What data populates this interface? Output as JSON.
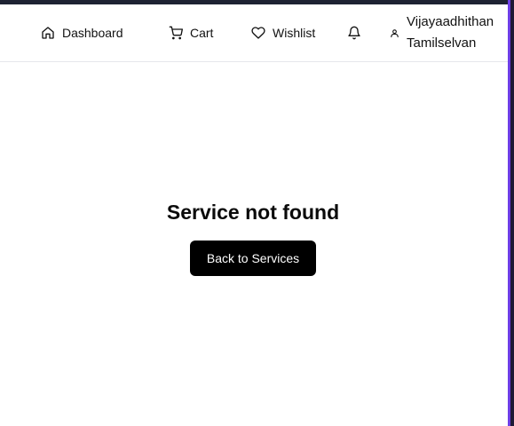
{
  "nav": {
    "dashboard": {
      "label": "Dashboard",
      "icon": "home-icon"
    },
    "cart": {
      "label": "Cart",
      "icon": "cart-icon"
    },
    "wishlist": {
      "label": "Wishlist",
      "icon": "heart-icon"
    },
    "notifications": {
      "icon": "bell-icon"
    },
    "user": {
      "name": "Vijayaadhithan Tamilselvan",
      "icon": "user-icon"
    }
  },
  "main": {
    "title": "Service not found",
    "back_button_label": "Back to Services"
  },
  "colors": {
    "button_bg": "#000000",
    "button_text": "#ffffff",
    "top_strip": "#1e2233",
    "edge_accent": "#6d3fe6"
  }
}
